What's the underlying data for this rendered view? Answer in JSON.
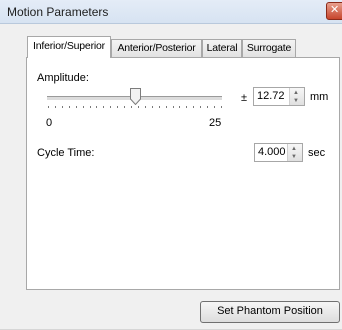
{
  "window": {
    "title": "Motion Parameters"
  },
  "tabs": [
    {
      "label": "Inferior/Superior",
      "active": true
    },
    {
      "label": "Anterior/Posterior",
      "active": false
    },
    {
      "label": "Lateral",
      "active": false
    },
    {
      "label": "Surrogate",
      "active": false
    }
  ],
  "amplitude": {
    "label": "Amplitude:",
    "slider_min_label": "0",
    "slider_max_label": "25",
    "slider_min": 0,
    "slider_max": 25,
    "slider_value": 12.72,
    "prefix": "±",
    "value": "12.72",
    "unit": "mm"
  },
  "cycle_time": {
    "label": "Cycle Time:",
    "value": "4.000",
    "unit": "sec"
  },
  "actions": {
    "set_phantom_label": "Set Phantom Position"
  },
  "colors": {
    "close_button": "#c7452c",
    "titlebar": "#dbe6f4"
  }
}
